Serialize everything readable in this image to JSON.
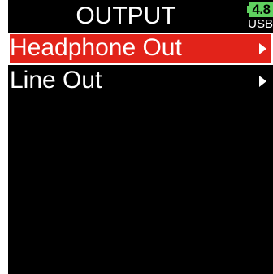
{
  "header": {
    "title": "OUTPUT"
  },
  "status": {
    "battery_voltage": "4.8",
    "power_source": "USB",
    "battery_color": "#5fd15f"
  },
  "menu": {
    "items": [
      {
        "label": "Headphone Out",
        "selected": true,
        "icon": "chevron-right-icon"
      },
      {
        "label": "Line Out",
        "selected": false,
        "icon": "chevron-right-icon"
      }
    ]
  },
  "colors": {
    "background": "#000000",
    "selection": "#e2231a",
    "text": "#ffffff"
  }
}
